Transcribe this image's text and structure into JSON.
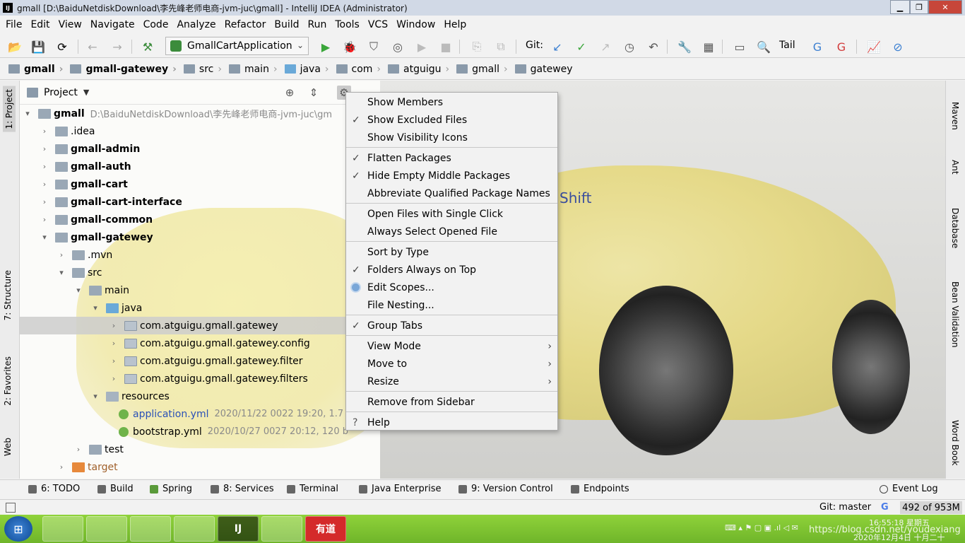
{
  "window": {
    "title": "gmall [D:\\BaiduNetdiskDownload\\李先峰老师电商-jvm-juc\\gmall] - IntelliJ IDEA (Administrator)",
    "app_icon_text": "IJ"
  },
  "menubar": [
    "File",
    "Edit",
    "View",
    "Navigate",
    "Code",
    "Analyze",
    "Refactor",
    "Build",
    "Run",
    "Tools",
    "VCS",
    "Window",
    "Help"
  ],
  "toolbar": {
    "run_config": "GmallCartApplication",
    "git_label": "Git:",
    "tail_label": "Tail"
  },
  "breadcrumbs": [
    "gmall",
    "gmall-gatewey",
    "src",
    "main",
    "java",
    "com",
    "atguigu",
    "gmall",
    "gatewey"
  ],
  "project_panel": {
    "title": "Project",
    "tree": [
      {
        "label": "gmall",
        "meta": "D:\\BaiduNetdiskDownload\\李先峰老师电商-jvm-juc\\gm"
      },
      {
        "label": ".idea"
      },
      {
        "label": "gmall-admin"
      },
      {
        "label": "gmall-auth"
      },
      {
        "label": "gmall-cart"
      },
      {
        "label": "gmall-cart-interface"
      },
      {
        "label": "gmall-common"
      },
      {
        "label": "gmall-gatewey"
      },
      {
        "label": ".mvn"
      },
      {
        "label": "src"
      },
      {
        "label": "main"
      },
      {
        "label": "java"
      },
      {
        "label": "com.atguigu.gmall.gatewey"
      },
      {
        "label": "com.atguigu.gmall.gatewey.config"
      },
      {
        "label": "com.atguigu.gmall.gatewey.filter"
      },
      {
        "label": "com.atguigu.gmall.gatewey.filters"
      },
      {
        "label": "resources"
      },
      {
        "label": "application.yml",
        "meta": "2020/11/22 0022 19:20, 1.7"
      },
      {
        "label": "bootstrap.yml",
        "meta": "2020/10/27 0027 20:12, 120 b"
      },
      {
        "label": "test"
      },
      {
        "label": "target"
      }
    ]
  },
  "context_menu": {
    "items": [
      {
        "label": "Show Members"
      },
      {
        "label": "Show Excluded Files"
      },
      {
        "label": "Show Visibility Icons"
      },
      {
        "label": "Flatten Packages"
      },
      {
        "label": "Hide Empty Middle Packages"
      },
      {
        "label": "Abbreviate Qualified Package Names"
      },
      {
        "label": "Open Files with Single Click"
      },
      {
        "label": "Always Select Opened File"
      },
      {
        "label": "Sort by Type"
      },
      {
        "label": "Folders Always on Top"
      },
      {
        "label": "Edit Scopes..."
      },
      {
        "label": "File Nesting..."
      },
      {
        "label": "Group Tabs"
      },
      {
        "label": "View Mode"
      },
      {
        "label": "Move to"
      },
      {
        "label": "Resize"
      },
      {
        "label": "Remove from Sidebar"
      },
      {
        "label": "Help"
      }
    ]
  },
  "editor": {
    "hint_fragment": "Shift"
  },
  "left_stripe": [
    "1: Project",
    "7: Structure",
    "2: Favorites",
    "Web"
  ],
  "right_stripe": [
    "Maven",
    "Ant",
    "Database",
    "Bean Validation",
    "Word Book"
  ],
  "bottom_tools": [
    "6: TODO",
    "Build",
    "Spring",
    "8: Services",
    "Terminal",
    "Java Enterprise",
    "9: Version Control",
    "Endpoints",
    "Event Log"
  ],
  "status_bar": {
    "git": "Git: master",
    "google": "G",
    "memory": "492 of 953M"
  },
  "taskbar": {
    "apps": [
      "",
      "",
      "",
      "",
      "IJ",
      "",
      "有道"
    ],
    "clock_time": "16:55:18 星期五",
    "clock_date": "2020年12月4日 十月二十",
    "watermark": "https://blog.csdn.net/youdexiang"
  }
}
